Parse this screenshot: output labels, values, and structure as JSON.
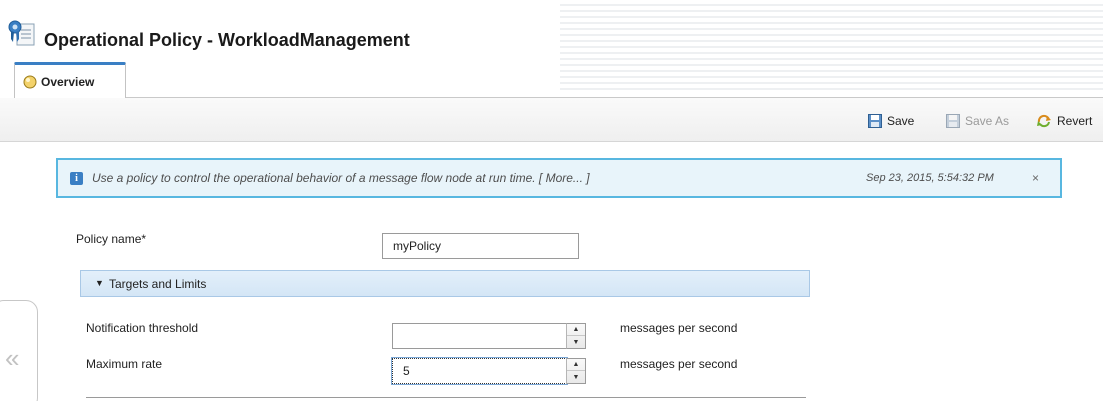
{
  "header": {
    "title": "Operational Policy - WorkloadManagement"
  },
  "tabs": [
    {
      "label": "Overview"
    }
  ],
  "toolbar": {
    "save": {
      "label": "Save"
    },
    "save_as": {
      "label": "Save As"
    },
    "revert": {
      "label": "Revert"
    }
  },
  "banner": {
    "text": "Use a policy to control the operational behavior of a message flow node at run time. [ More... ]",
    "timestamp": "Sep 23, 2015, 5:54:32 PM",
    "close": "×"
  },
  "form": {
    "policy_name": {
      "label": "Policy name*",
      "value": "myPolicy"
    },
    "section": {
      "label": "Targets and Limits",
      "expanded": true
    },
    "notification_threshold": {
      "label": "Notification threshold",
      "value": "",
      "unit": "messages per second"
    },
    "maximum_rate": {
      "label": "Maximum rate",
      "value": "5",
      "unit": "messages per second"
    }
  },
  "colors": {
    "accent": "#3a7fc4",
    "banner_border": "#58b7e0",
    "banner_bg": "#e8f4fa",
    "section_bg": "#d9e9f7"
  }
}
